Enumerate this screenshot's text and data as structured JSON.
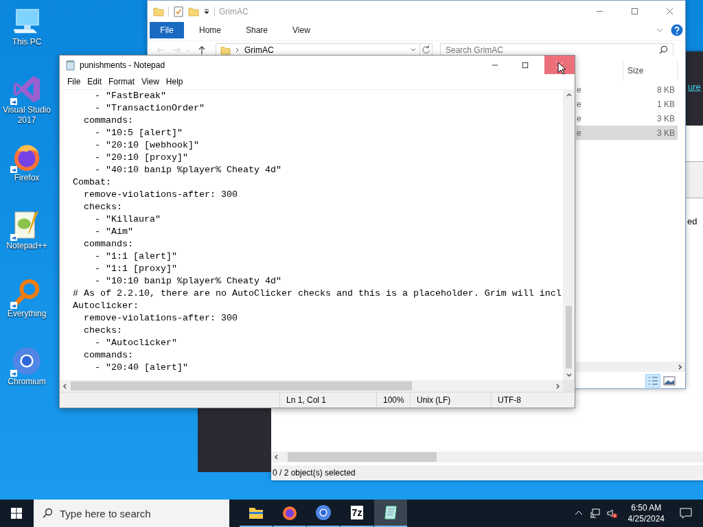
{
  "desktop_icons": [
    {
      "kind": "pc",
      "label": "This PC",
      "shortcut": false
    },
    {
      "kind": "vs",
      "label": "Visual Studio 2017",
      "shortcut": true
    },
    {
      "kind": "firefox",
      "label": "Firefox",
      "shortcut": true
    },
    {
      "kind": "notepadpp",
      "label": "Notepad++",
      "shortcut": true
    },
    {
      "kind": "everything",
      "label": "Everything",
      "shortcut": true
    },
    {
      "kind": "chromium",
      "label": "Chromium",
      "shortcut": true
    }
  ],
  "back_window": {
    "link": "ure",
    "text": "ed",
    "status": "0 / 2 object(s) selected"
  },
  "explorer": {
    "title": "GrimAC",
    "ribbon_tabs": [
      {
        "label": "File",
        "selected": true
      },
      {
        "label": "Home",
        "selected": false
      },
      {
        "label": "Share",
        "selected": false
      },
      {
        "label": "View",
        "selected": false
      }
    ],
    "address": "GrimAC",
    "search": {
      "placeholder": "Search GrimAC"
    },
    "columns": [
      "Size"
    ],
    "rows": [
      {
        "column_1": "e",
        "size": "8 KB",
        "selected": false
      },
      {
        "column_1": "e",
        "size": "1 KB",
        "selected": false
      },
      {
        "column_1": "e",
        "size": "3 KB",
        "selected": false
      },
      {
        "column_1": "e",
        "size": "3 KB",
        "selected": true
      }
    ]
  },
  "notepad": {
    "title": "punishments - Notepad",
    "menu": [
      "File",
      "Edit",
      "Format",
      "View",
      "Help"
    ],
    "lines": [
      "    - \"FastBreak\"",
      "    - \"TransactionOrder\"",
      "  commands:",
      "    - \"10:5 [alert]\"",
      "    - \"20:10 [webhook]\"",
      "    - \"20:10 [proxy]\"",
      "    - \"40:10 banip %player% Cheaty 4d\"",
      "Combat:",
      "  remove-violations-after: 300",
      "  checks:",
      "    - \"Killaura\"",
      "    - \"Aim\"",
      "  commands:",
      "    - \"1:1 [alert]\"",
      "    - \"1:1 [proxy]\"",
      "    - \"10:10 banip %player% Cheaty 4d\"",
      "# As of 2.2.10, there are no AutoClicker checks and this is a placeholder. Grim will incl",
      "Autoclicker:",
      "  remove-violations-after: 300",
      "  checks:",
      "    - \"Autoclicker\"",
      "  commands:",
      "    - \"20:40 [alert]\""
    ],
    "status": [
      "Ln 1, Col 1",
      "100%",
      "Unix (LF)",
      "UTF-8"
    ]
  },
  "taskbar": {
    "search": {
      "placeholder": "Type here to search"
    },
    "apps": [
      {
        "kind": "explorer",
        "selected": false
      },
      {
        "kind": "firefox",
        "selected": false
      },
      {
        "kind": "chromium",
        "selected": false
      },
      {
        "kind": "sevenzip",
        "glyph": "7z",
        "selected": false
      },
      {
        "kind": "notepad",
        "selected": true
      }
    ],
    "time": "6:50 AM",
    "date": "4/25/2024"
  }
}
